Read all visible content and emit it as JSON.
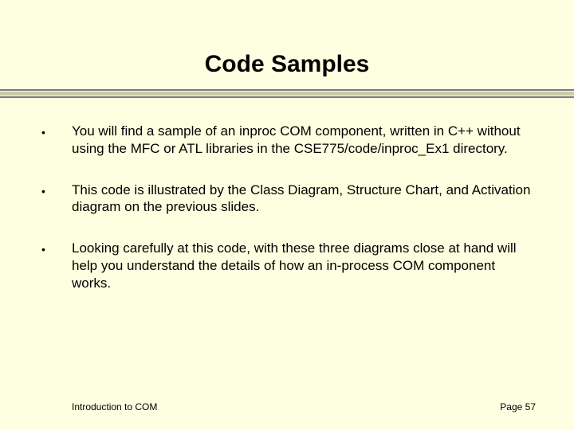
{
  "slide": {
    "title": "Code Samples",
    "bullets": [
      "You will find a sample of an inproc COM component, written in C++ without using the MFC or ATL libraries in the CSE775/code/inproc_Ex1 directory.",
      "This code is illustrated by the Class Diagram, Structure Chart, and Activation diagram on the previous slides.",
      "Looking carefully at this code, with these three diagrams close at hand will help you understand the details of how an in-process COM component works."
    ],
    "footer_left": "Introduction to COM",
    "footer_right": "Page 57"
  }
}
